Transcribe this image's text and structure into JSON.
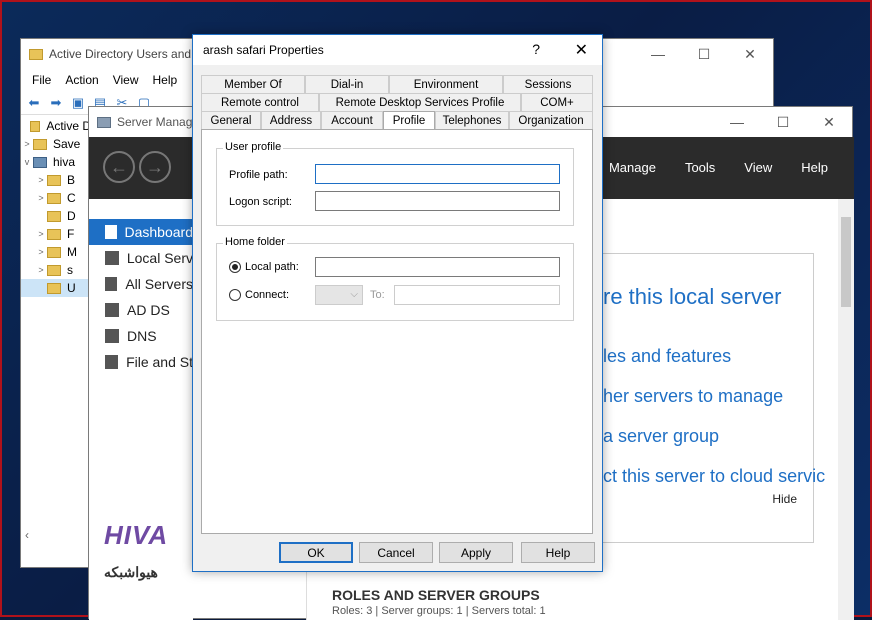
{
  "ad_window": {
    "title": "Active Directory Users and",
    "menu": [
      "File",
      "Action",
      "View",
      "Help"
    ],
    "tree": [
      {
        "label": "Active D",
        "arrow": ""
      },
      {
        "label": "Save",
        "arrow": ">"
      },
      {
        "label": "hiva",
        "arrow": "v"
      },
      {
        "label": "B",
        "arrow": ">"
      },
      {
        "label": "C",
        "arrow": ">"
      },
      {
        "label": "D",
        "arrow": ""
      },
      {
        "label": "F",
        "arrow": ">"
      },
      {
        "label": "M",
        "arrow": ">"
      },
      {
        "label": "s",
        "arrow": ">"
      },
      {
        "label": "U",
        "arrow": ""
      }
    ]
  },
  "server_manager": {
    "title": "Server Manag",
    "menu": [
      "Manage",
      "Tools",
      "View",
      "Help"
    ],
    "sidebar": [
      "Dashboard",
      "Local Serv",
      "All Servers",
      "AD DS",
      "DNS",
      "File and St"
    ],
    "welcome_lines": [
      "re this local server",
      "les and features",
      "her servers to manage",
      "a server group",
      "ct this server to cloud servic"
    ],
    "hide_label": "Hide",
    "roles_title": "ROLES AND SERVER GROUPS",
    "roles_sub": "Roles: 3   |   Server groups: 1   |   Servers total: 1"
  },
  "dialog": {
    "title": "arash safari Properties",
    "help_glyph": "?",
    "close_glyph": "✕",
    "tabs_row1": [
      "Member Of",
      "Dial-in",
      "Environment",
      "Sessions"
    ],
    "tabs_row2": [
      "Remote control",
      "Remote Desktop Services Profile",
      "COM+"
    ],
    "tabs_row3": [
      "General",
      "Address",
      "Account",
      "Profile",
      "Telephones",
      "Organization"
    ],
    "selected_tab": "Profile",
    "user_profile": {
      "legend": "User profile",
      "profile_path_label": "Profile path:",
      "profile_path_value": "",
      "logon_script_label": "Logon script:",
      "logon_script_value": ""
    },
    "home_folder": {
      "legend": "Home folder",
      "local_path_label": "Local path:",
      "local_path_value": "",
      "connect_label": "Connect:",
      "to_label": "To:",
      "selected": "local_path"
    },
    "buttons": {
      "ok": "OK",
      "cancel": "Cancel",
      "apply": "Apply",
      "help": "Help"
    }
  },
  "watermark": {
    "brand": "HIVA",
    "persian": "هیواشبکه"
  },
  "colors": {
    "accent": "#1e6fc5",
    "dark_header": "#2b2b2b",
    "brand_purple": "#6f4aa3"
  }
}
